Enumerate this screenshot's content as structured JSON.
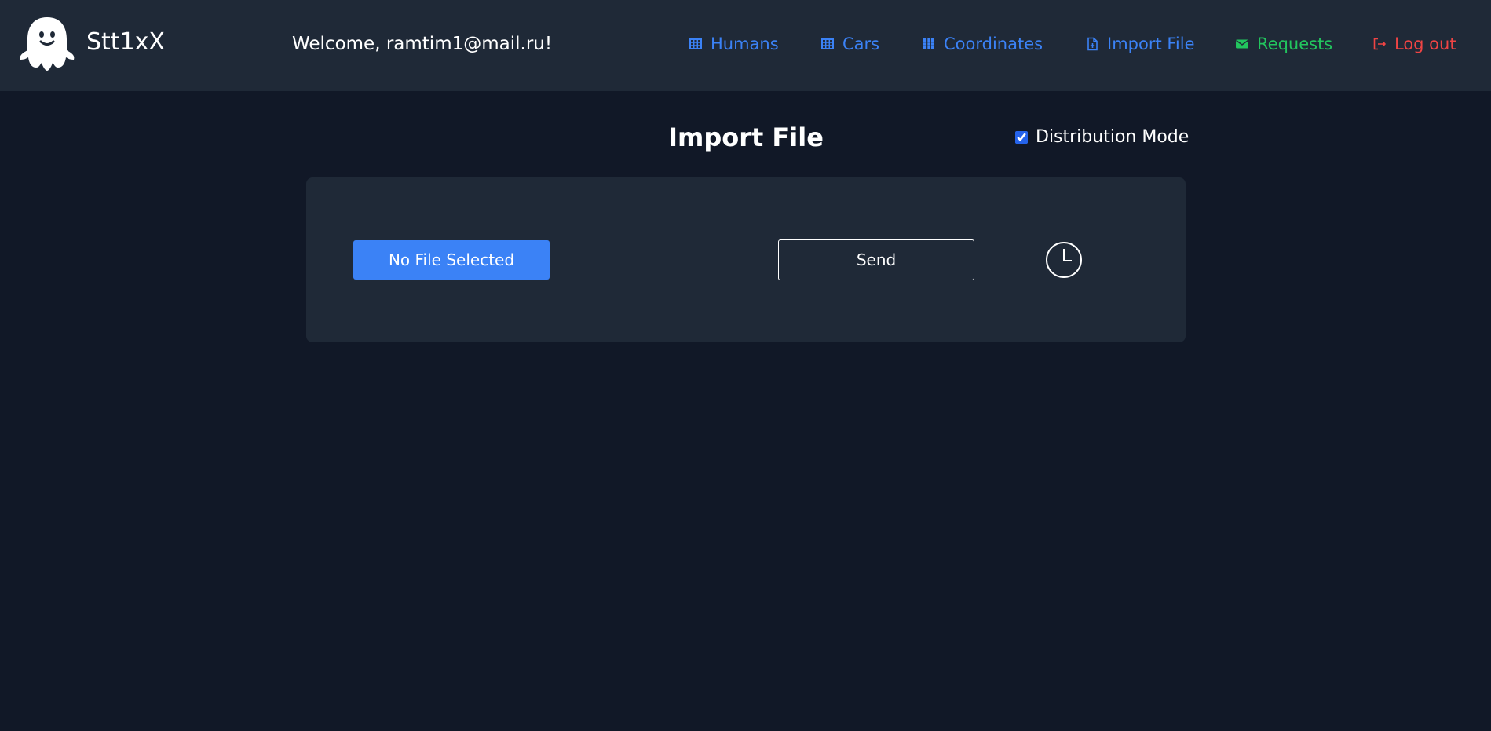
{
  "header": {
    "brand": "Stt1xX",
    "welcome": "Welcome, ramtim1@mail.ru!",
    "nav": [
      {
        "label": "Humans",
        "icon": "table-icon",
        "color": "#3b82f6"
      },
      {
        "label": "Cars",
        "icon": "table-icon",
        "color": "#3b82f6"
      },
      {
        "label": "Coordinates",
        "icon": "grid-icon",
        "color": "#3b82f6"
      },
      {
        "label": "Import File",
        "icon": "file-import-icon",
        "color": "#3b82f6"
      },
      {
        "label": "Requests",
        "icon": "envelope-icon",
        "color": "#22c55e"
      },
      {
        "label": "Log out",
        "icon": "logout-icon",
        "color": "#ef4444"
      }
    ]
  },
  "main": {
    "title": "Import File",
    "distribution_mode": {
      "label": "Distribution Mode",
      "checked": true
    },
    "file_button": "No File Selected",
    "send_button": "Send",
    "history_icon": "clock-icon"
  },
  "colors": {
    "background": "#111827",
    "panel": "#1f2937",
    "accent": "#3b82f6"
  }
}
